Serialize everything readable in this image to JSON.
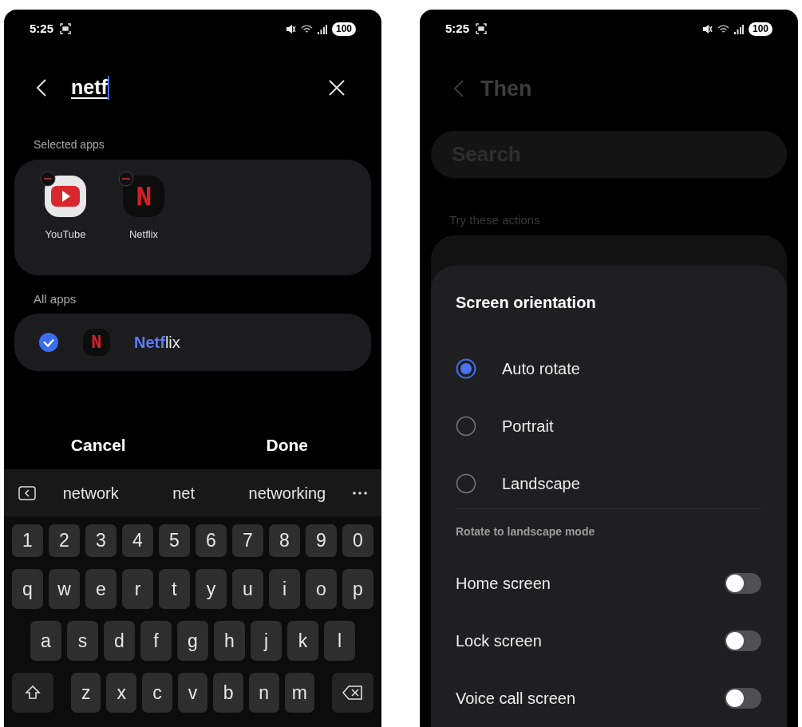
{
  "left_phone": {
    "status_bar": {
      "time": "5:25",
      "battery": "100"
    },
    "search": {
      "value": "netf"
    },
    "selected_section": {
      "title": "Selected apps",
      "apps": [
        {
          "name": "YouTube",
          "kind": "youtube"
        },
        {
          "name": "Netflix",
          "kind": "netflix",
          "logo_letter": "N"
        }
      ]
    },
    "all_section": {
      "title": "All apps",
      "apps": [
        {
          "match": "Netf",
          "rest": "lix",
          "kind": "netflix",
          "logo_letter": "N",
          "checked": true
        }
      ]
    },
    "buttons": [
      "Cancel",
      "Done"
    ],
    "suggestions": [
      "network",
      "net",
      "networking"
    ],
    "keyboard": {
      "rows": [
        {
          "keys": [
            "1",
            "2",
            "3",
            "4",
            "5",
            "6",
            "7",
            "8",
            "9",
            "0"
          ]
        },
        {
          "keys": [
            "q",
            "w",
            "e",
            "r",
            "t",
            "y",
            "u",
            "i",
            "o",
            "p"
          ]
        },
        {
          "keys": [
            "a",
            "s",
            "d",
            "f",
            "g",
            "h",
            "j",
            "k",
            "l"
          ]
        },
        {
          "keys": [
            "z",
            "x",
            "c",
            "v",
            "b",
            "n",
            "m"
          ],
          "side_keys": [
            {
              "kind": "shift"
            },
            {
              "kind": "backspace"
            }
          ]
        }
      ]
    }
  },
  "right_phone": {
    "status_bar": {
      "time": "5:25",
      "battery": "100"
    },
    "header": {
      "title": "Then"
    },
    "search": {
      "placeholder": "Search"
    },
    "section_title": "Try these actions",
    "sheet": {
      "title": "Screen orientation",
      "options": [
        {
          "label": "Auto rotate",
          "selected": true
        },
        {
          "label": "Portrait",
          "selected": false
        },
        {
          "label": "Landscape",
          "selected": false
        }
      ],
      "subtitle": "Rotate to landscape mode",
      "toggles": [
        {
          "label": "Home screen",
          "on": false
        },
        {
          "label": "Lock screen",
          "on": false
        },
        {
          "label": "Voice call screen",
          "on": false
        }
      ]
    }
  }
}
